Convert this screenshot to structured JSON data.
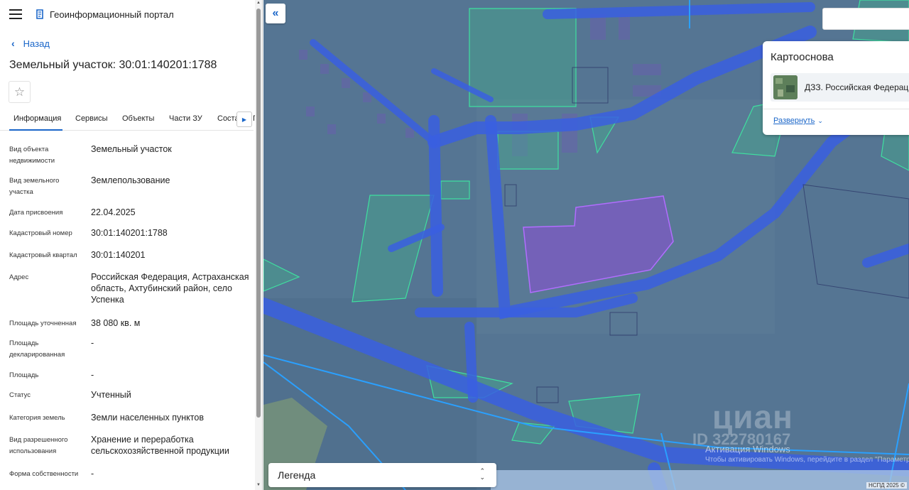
{
  "header": {
    "title": "Геоинформационный портал"
  },
  "nav": {
    "back_label": "Назад"
  },
  "parcel": {
    "title": "Земельный участок: 30:01:140201:1788"
  },
  "tabs": [
    {
      "label": "Информация"
    },
    {
      "label": "Сервисы"
    },
    {
      "label": "Объекты"
    },
    {
      "label": "Части ЗУ"
    },
    {
      "label": "Соста"
    },
    {
      "label": "Г"
    }
  ],
  "properties": [
    {
      "label": "Вид объекта недвижимости",
      "value": "Земельный участок"
    },
    {
      "label": "Вид земельного участка",
      "value": "Землепользование"
    },
    {
      "label": "Дата присвоения",
      "value": "22.04.2025"
    },
    {
      "label": "Кадастровый номер",
      "value": "30:01:140201:1788"
    },
    {
      "label": "Кадастровый квартал",
      "value": "30:01:140201"
    },
    {
      "label": "Адрес",
      "value": "Российская Федерация, Астраханская область, Ахтубинский район, село Успенка"
    },
    {
      "label": "Площадь уточненная",
      "value": "38 080 кв. м"
    },
    {
      "label": "Площадь декларированная",
      "value": "-"
    },
    {
      "label": "Площадь",
      "value": "-"
    },
    {
      "label": "Статус",
      "value": "Учтенный"
    },
    {
      "label": "Категория земель",
      "value": "Земли населенных пунктов"
    },
    {
      "label": "Вид разрешенного использования",
      "value": "Хранение и переработка сельскохозяйственной продукции"
    },
    {
      "label": "Форма собственности",
      "value": "-"
    }
  ],
  "map": {
    "collapse_glyph": "«",
    "basemap": {
      "title": "Картооснова",
      "selected_name": "ДЗЗ. Российская Федерация",
      "expand_label": "Развернуть"
    },
    "legend_label": "Легенда",
    "watermark": {
      "brand": "циан",
      "id": "ID 322780167",
      "windows_line1": "Активация Windows",
      "windows_line2": "Чтобы активировать Windows, перейдите в раздел \"Параметры\"."
    },
    "attribution": "НСПД 2025 ©"
  },
  "colors": {
    "accent": "#1a66c9",
    "parcel_fill": "#8a4fd6",
    "road_blue": "#3a5fe0",
    "zone_green": "#3fb88a"
  },
  "icons": {
    "menu": "menu-icon",
    "logo": "portal-logo-icon",
    "back": "chevron-left-icon",
    "favorite": "star-icon",
    "tabs_next": "chevron-right-icon",
    "collapse": "double-chevron-left-icon",
    "expand": "chevron-down-icon",
    "legend_toggle": "sort-arrows-icon"
  }
}
